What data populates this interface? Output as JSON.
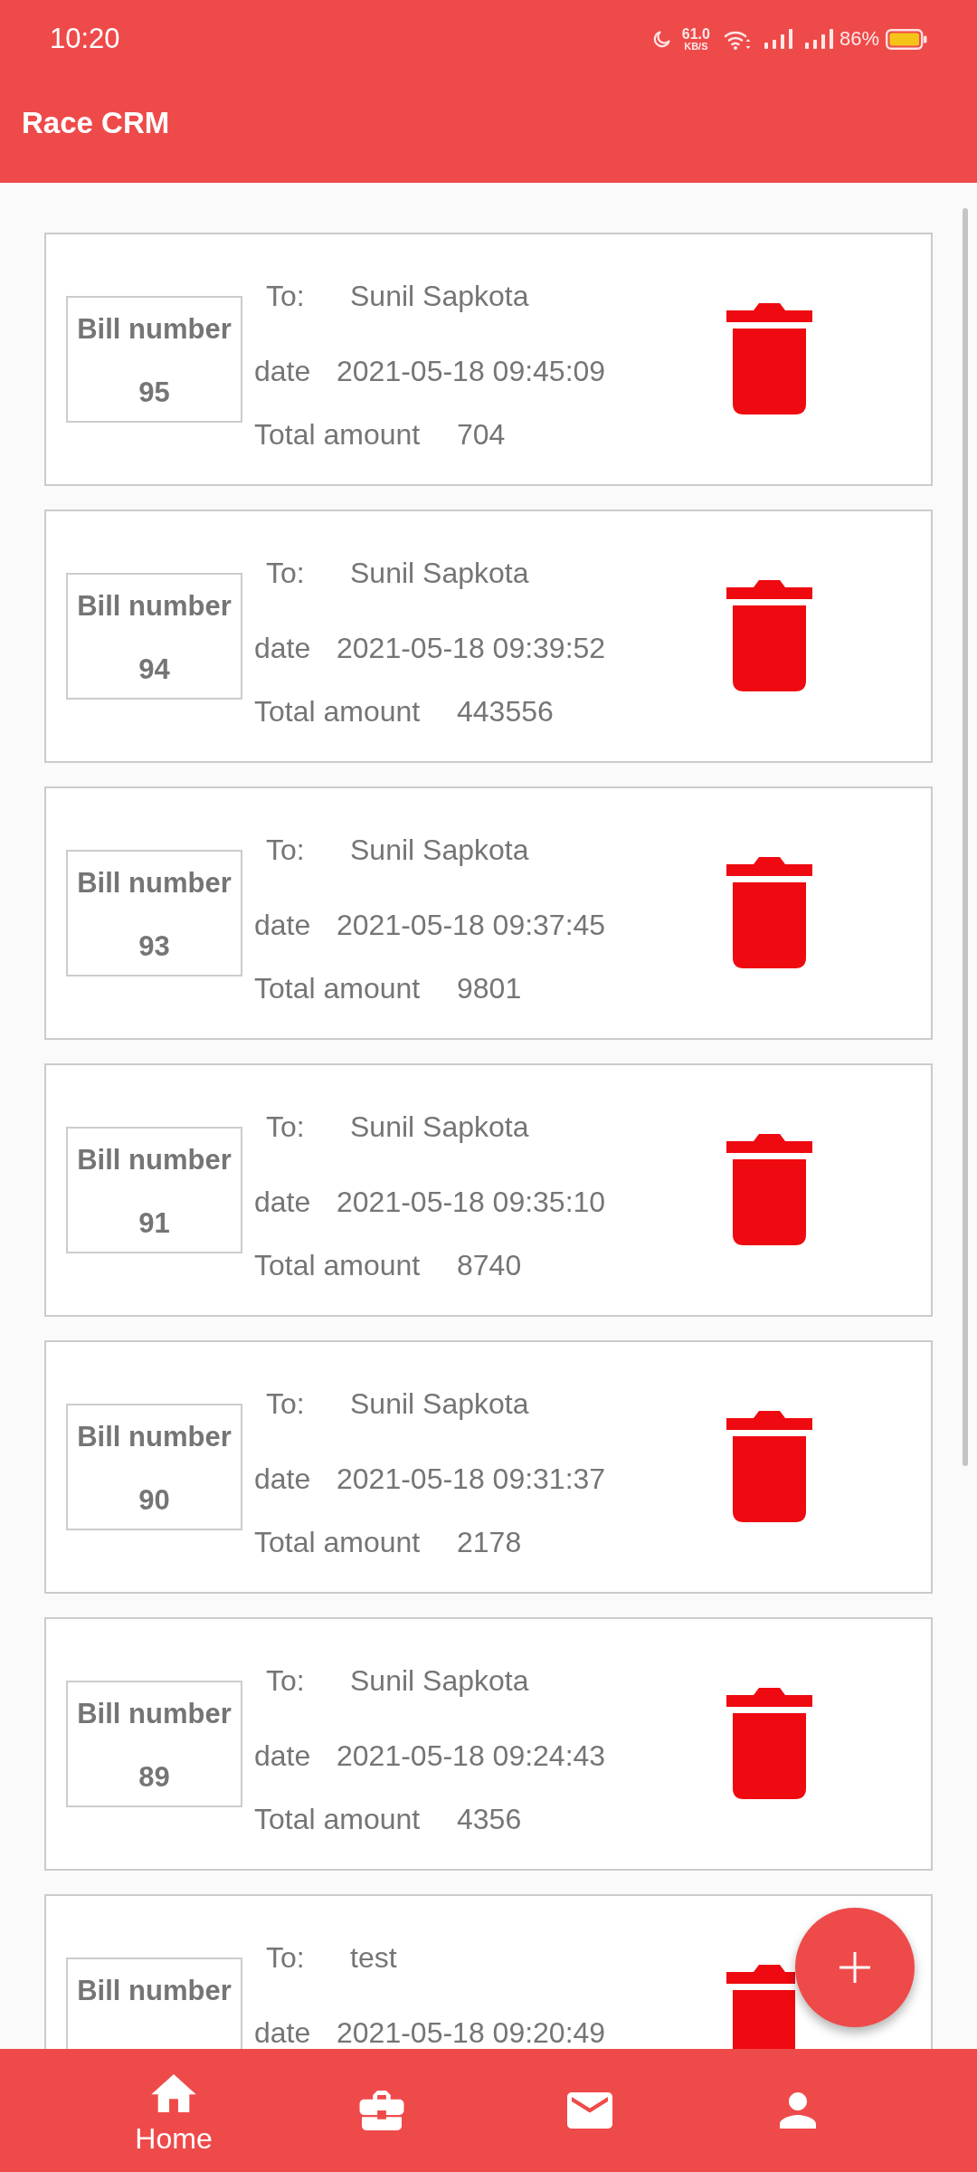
{
  "status_bar": {
    "time": "10:20",
    "speed_value": "61.0",
    "speed_unit": "KB/S",
    "battery": "86%"
  },
  "app_bar": {
    "title": "Race CRM"
  },
  "bills": [
    {
      "number_label": "Bill number",
      "number": "95",
      "to_label": "To:",
      "to": "Sunil Sapkota",
      "date_label": "date",
      "date": "2021-05-18 09:45:09",
      "total_label": "Total amount",
      "total": "704"
    },
    {
      "number_label": "Bill number",
      "number": "94",
      "to_label": "To:",
      "to": "Sunil Sapkota",
      "date_label": "date",
      "date": "2021-05-18 09:39:52",
      "total_label": "Total amount",
      "total": "443556"
    },
    {
      "number_label": "Bill number",
      "number": "93",
      "to_label": "To:",
      "to": "Sunil Sapkota",
      "date_label": "date",
      "date": "2021-05-18 09:37:45",
      "total_label": "Total amount",
      "total": "9801"
    },
    {
      "number_label": "Bill number",
      "number": "91",
      "to_label": "To:",
      "to": "Sunil Sapkota",
      "date_label": "date",
      "date": "2021-05-18 09:35:10",
      "total_label": "Total amount",
      "total": "8740"
    },
    {
      "number_label": "Bill number",
      "number": "90",
      "to_label": "To:",
      "to": "Sunil Sapkota",
      "date_label": "date",
      "date": "2021-05-18 09:31:37",
      "total_label": "Total amount",
      "total": "2178"
    },
    {
      "number_label": "Bill number",
      "number": "89",
      "to_label": "To:",
      "to": "Sunil Sapkota",
      "date_label": "date",
      "date": "2021-05-18 09:24:43",
      "total_label": "Total amount",
      "total": "4356"
    },
    {
      "number_label": "Bill number",
      "to_label": "To:",
      "to": "test",
      "date_label": "date",
      "date": "2021-05-18 09:20:49"
    }
  ],
  "bottom_nav": [
    {
      "kind": "home",
      "label": "Home",
      "selected": true
    },
    {
      "kind": "briefcase",
      "selected": false
    },
    {
      "kind": "mail",
      "selected": false
    },
    {
      "kind": "person",
      "selected": false
    }
  ]
}
